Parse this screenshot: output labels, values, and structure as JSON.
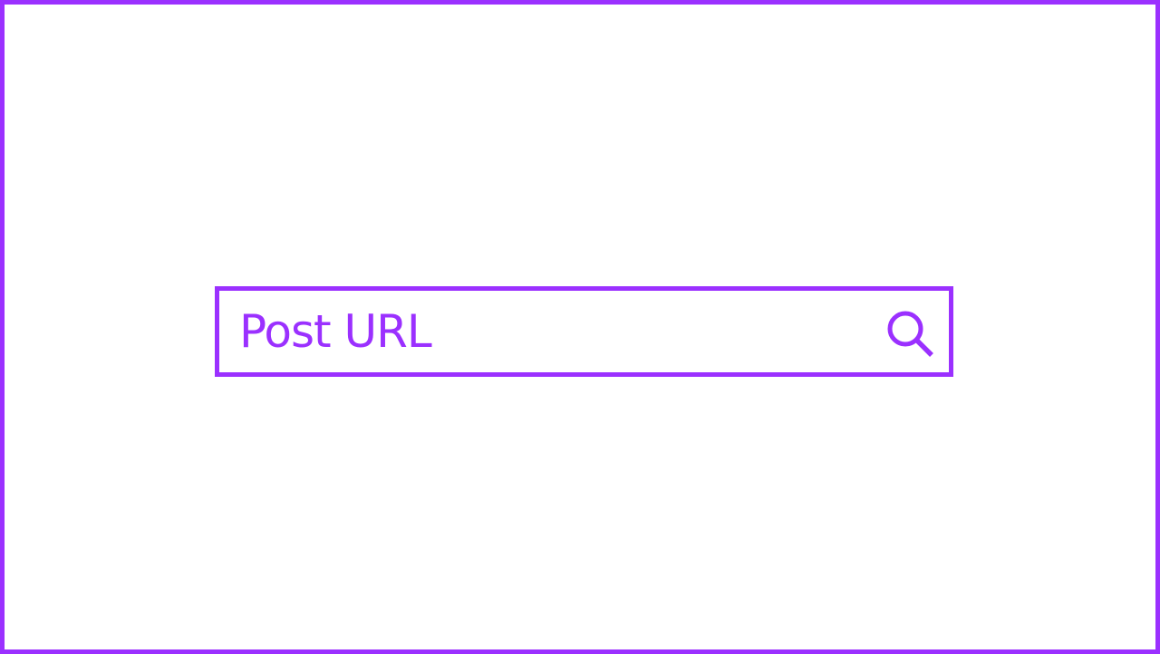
{
  "colors": {
    "accent": "#9b30ff",
    "background": "#ffffff"
  },
  "search": {
    "placeholder": "Post URL",
    "value": "",
    "icon": "search-icon"
  }
}
